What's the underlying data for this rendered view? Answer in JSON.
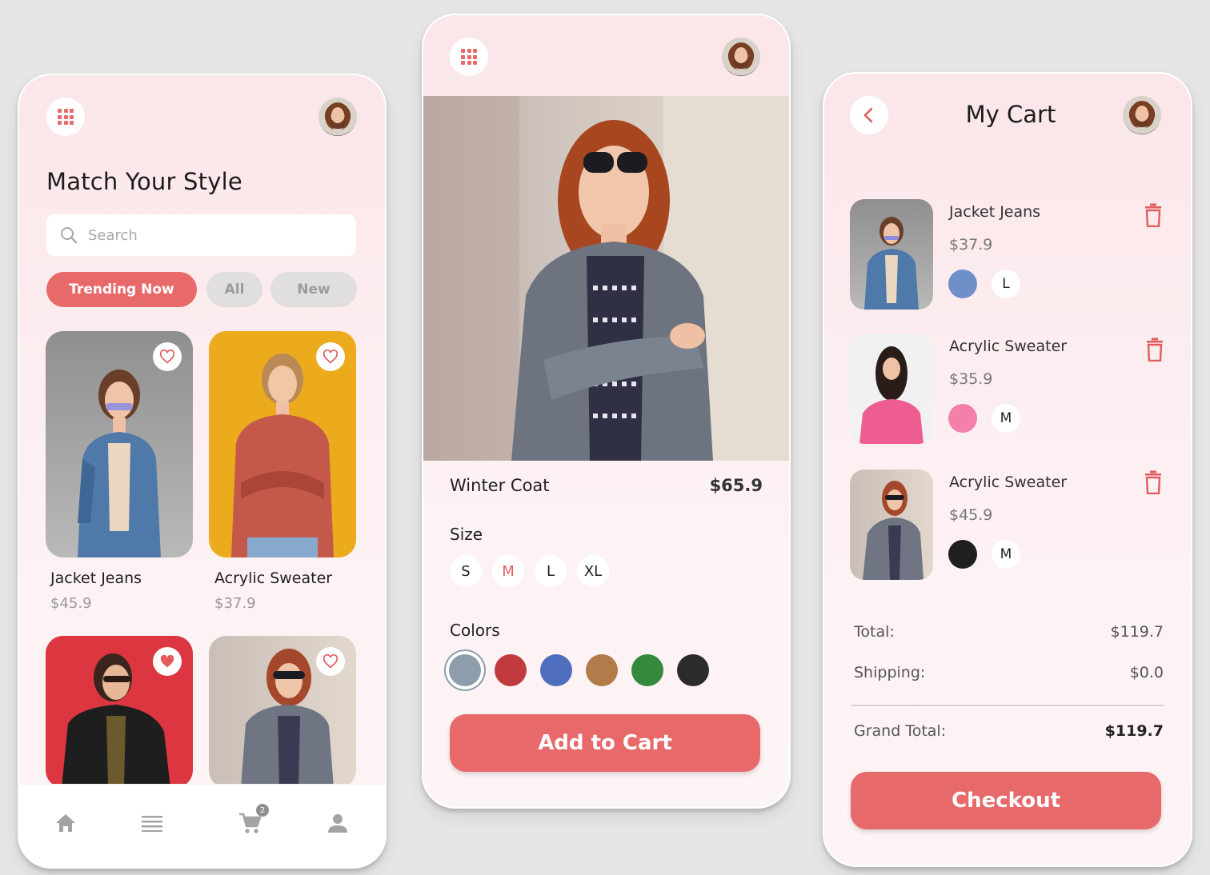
{
  "home": {
    "title": "Match Your Style",
    "search_placeholder": "Search",
    "chips": [
      "Trending Now",
      "All",
      "New"
    ],
    "products": [
      {
        "name": "Jacket Jeans",
        "price": "$45.9",
        "bg": "#9e9e9e"
      },
      {
        "name": "Acrylic Sweater",
        "price": "$37.9",
        "bg": "#ebab1c"
      }
    ],
    "cart_badge": "2",
    "nav": [
      "home-icon",
      "list-icon",
      "cart-icon",
      "user-icon"
    ]
  },
  "detail": {
    "name": "Winter Coat",
    "price": "$65.9",
    "size_label": "Size",
    "sizes": [
      "S",
      "M",
      "L",
      "XL"
    ],
    "selected_size": "M",
    "colors_label": "Colors",
    "colors": [
      "#8e9dab",
      "#c13a3d",
      "#4f6ebd",
      "#b17c4a",
      "#368a3d",
      "#2b2b2b"
    ],
    "button": "Add to Cart"
  },
  "cart": {
    "title": "My Cart",
    "items": [
      {
        "name": "Jacket Jeans",
        "price": "$37.9",
        "color": "#6e8fc7",
        "size": "L"
      },
      {
        "name": "Acrylic Sweater",
        "price": "$35.9",
        "color": "#f37fab",
        "size": "M"
      },
      {
        "name": "Acrylic Sweater",
        "price": "$45.9",
        "color": "#1f1f1f",
        "size": "M"
      }
    ],
    "total_label": "Total:",
    "total_value": "$119.7",
    "shipping_label": "Shipping:",
    "shipping_value": "$0.0",
    "grand_label": "Grand Total:",
    "grand_value": "$119.7",
    "button": "Checkout"
  },
  "colors": {
    "accent": "#e8696a",
    "background": "#e6e6e6"
  }
}
